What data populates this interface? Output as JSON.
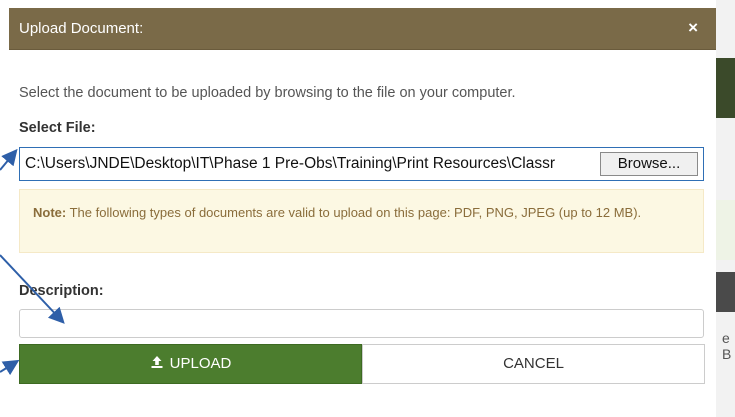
{
  "dialog": {
    "title": "Upload Document:",
    "close_icon": "×",
    "intro": "Select the document to be uploaded by browsing to the file on your computer."
  },
  "file": {
    "label": "Select File:",
    "path": "C:\\Users\\JNDE\\Desktop\\IT\\Phase 1 Pre-Obs\\Training\\Print Resources\\Classr",
    "browse_label": "Browse..."
  },
  "note": {
    "prefix": "Note:",
    "text": " The following types of documents are valid to upload on this page: PDF, PNG, JPEG (up to 12 MB)."
  },
  "description": {
    "label": "Description:",
    "value": ""
  },
  "buttons": {
    "upload_icon": "upload-icon",
    "upload_label": "UPLOAD",
    "cancel_label": "CANCEL"
  },
  "background": {
    "edge_text": "e B"
  },
  "colors": {
    "header": "#7a6a48",
    "upload_button": "#4c7d2e",
    "note_background": "#fcf8e3",
    "annotation_arrow": "#2e5fa8"
  }
}
